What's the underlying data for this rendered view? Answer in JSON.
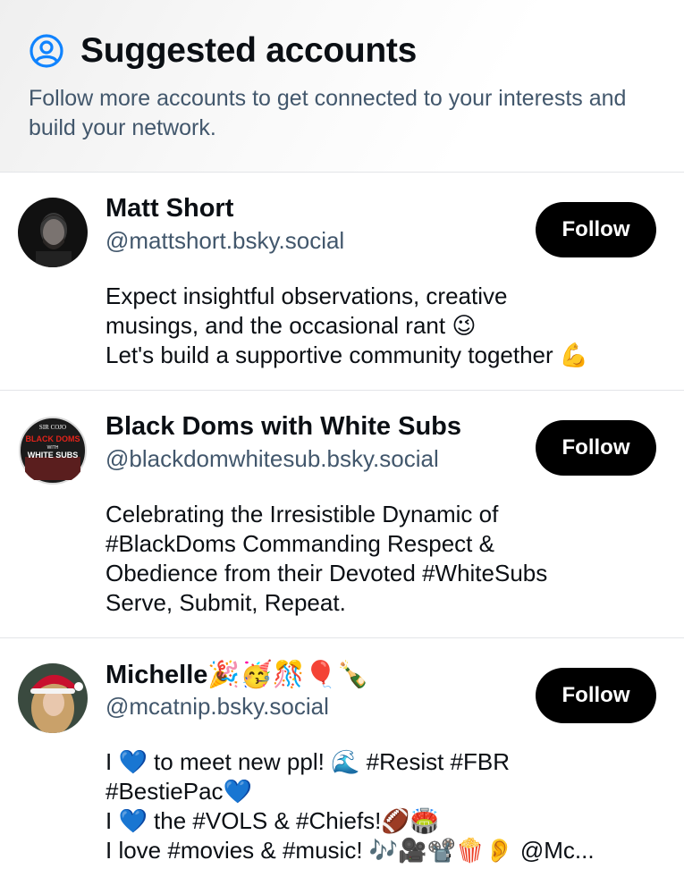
{
  "header": {
    "title": "Suggested accounts",
    "subtitle": "Follow more accounts to get connected to your interests and build your network.",
    "icon": "user-circle-icon",
    "accent": "#1083fe"
  },
  "accounts": [
    {
      "name": "Matt Short",
      "handle": "@mattshort.bsky.social",
      "follow_label": "Follow",
      "bio": [
        "Expect insightful observations, creative",
        "musings, and the occasional rant 😉",
        "Let's build a supportive community together 💪"
      ]
    },
    {
      "name": "Black Doms with White Subs",
      "handle": "@blackdomwhitesub.bsky.social",
      "follow_label": "Follow",
      "avatar_text": [
        "SIR COJO",
        "BLACK DOMS",
        "WITH",
        "WHITE SUBS"
      ],
      "bio": [
        "Celebrating the Irresistible Dynamic of",
        "#BlackDoms Commanding Respect &",
        "Obedience from their Devoted #WhiteSubs",
        "Serve, Submit, Repeat."
      ]
    },
    {
      "name": "Michelle🎉🥳🎊🎈🍾",
      "handle": "@mcatnip.bsky.social",
      "follow_label": "Follow",
      "bio": [
        "I 💙 to meet new ppl! 🌊 #Resist #FBR",
        "#BestiePac💙",
        "I 💙 the #VOLS & #Chiefs!🏈🏟️",
        "I love #movies & #music! 🎶🎥📽️🍿👂 @Mc..."
      ]
    }
  ]
}
